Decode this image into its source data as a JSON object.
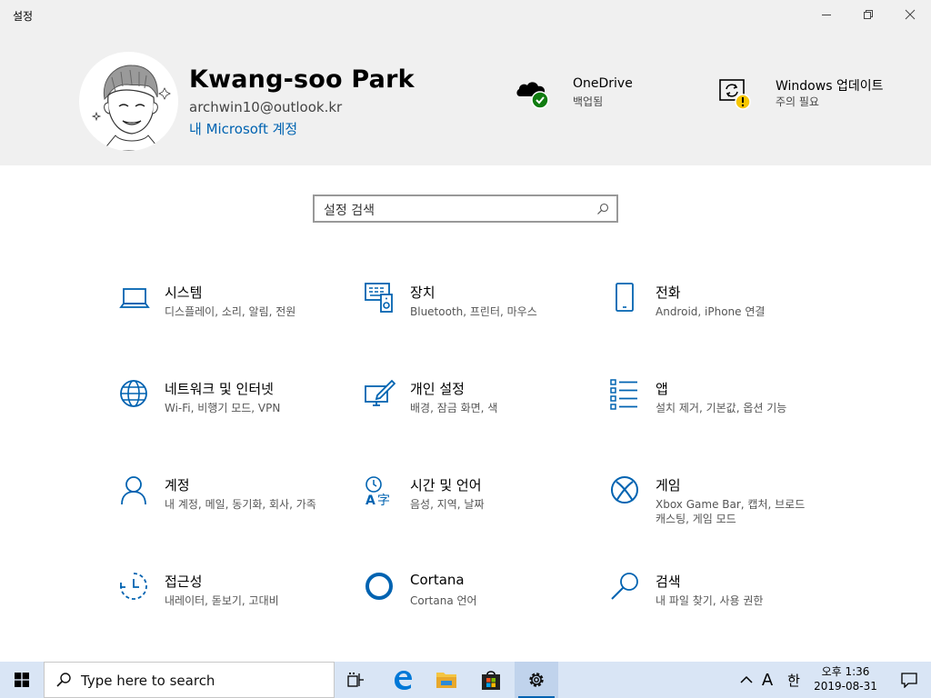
{
  "window": {
    "title": "설정"
  },
  "profile": {
    "name": "Kwang-soo Park",
    "email": "archwin10@outlook.kr",
    "account_link": "내 Microsoft 계정"
  },
  "status": [
    {
      "title": "OneDrive",
      "subtitle": "백업됨",
      "icon": "onedrive-backed-up-icon"
    },
    {
      "title": "Windows 업데이트",
      "subtitle": "주의 필요",
      "icon": "windows-update-warning-icon"
    }
  ],
  "search": {
    "placeholder": "설정 검색"
  },
  "categories": [
    {
      "name": "시스템",
      "desc": "디스플레이, 소리, 알림, 전원",
      "icon": "laptop-icon"
    },
    {
      "name": "장치",
      "desc": "Bluetooth, 프린터, 마우스",
      "icon": "devices-icon"
    },
    {
      "name": "전화",
      "desc": "Android, iPhone 연결",
      "icon": "phone-icon"
    },
    {
      "name": "네트워크 및 인터넷",
      "desc": "Wi-Fi, 비행기 모드, VPN",
      "icon": "globe-icon"
    },
    {
      "name": "개인 설정",
      "desc": "배경, 잠금 화면, 색",
      "icon": "personalization-icon"
    },
    {
      "name": "앱",
      "desc": "설치 제거, 기본값, 옵션 기능",
      "icon": "apps-list-icon"
    },
    {
      "name": "계정",
      "desc": "내 계정, 메일, 동기화, 회사, 가족",
      "icon": "person-icon"
    },
    {
      "name": "시간 및 언어",
      "desc": "음성, 지역, 날짜",
      "icon": "time-language-icon"
    },
    {
      "name": "게임",
      "desc": "Xbox Game Bar, 캡처, 브로드캐스팅, 게임 모드",
      "icon": "xbox-icon"
    },
    {
      "name": "접근성",
      "desc": "내레이터, 돋보기, 고대비",
      "icon": "ease-of-access-icon"
    },
    {
      "name": "Cortana",
      "desc": "Cortana 언어",
      "icon": "cortana-icon"
    },
    {
      "name": "검색",
      "desc": "내 파일 찾기, 사용 권한",
      "icon": "search-icon"
    }
  ],
  "taskbar": {
    "search_placeholder": "Type here to search",
    "ime_mode": "A",
    "ime_lang": "한",
    "time": "오후 1:36",
    "date": "2019-08-31"
  },
  "colors": {
    "accent": "#0063b1",
    "header_bg": "#f0f0f0",
    "taskbar_bg": "#d9e5f5"
  }
}
